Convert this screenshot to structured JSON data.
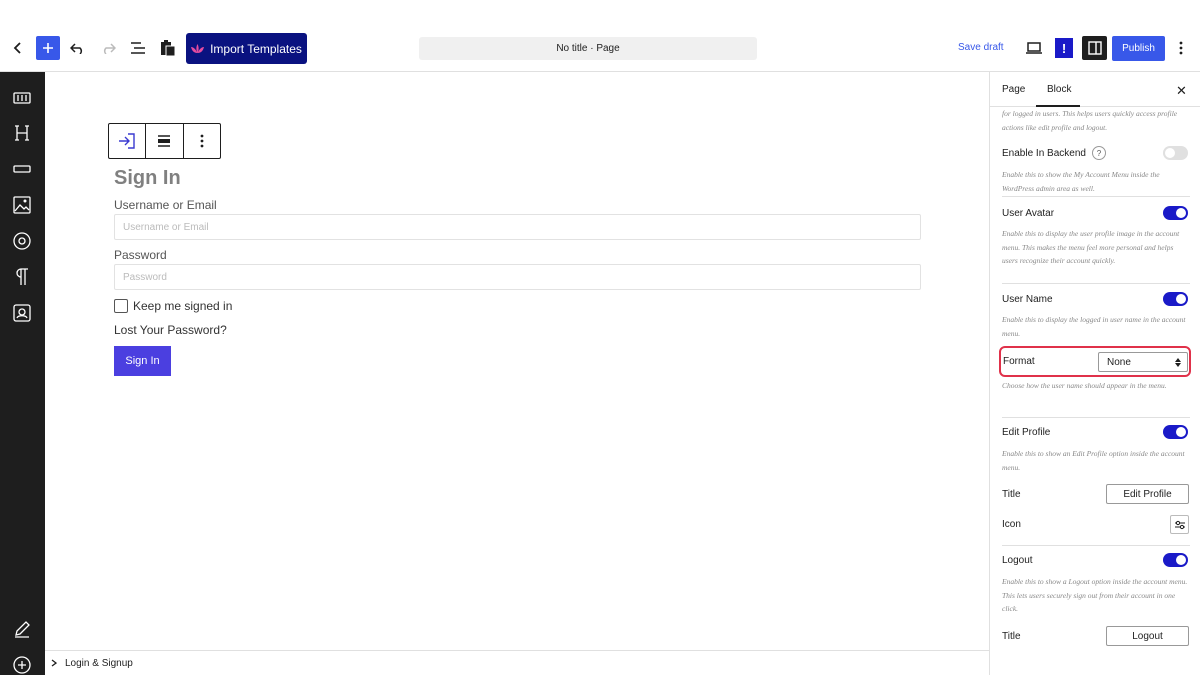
{
  "toolbar": {
    "import_label": "Import Templates",
    "doc_title": "No title · Page",
    "save_draft": "Save draft",
    "alert": "!",
    "publish": "Publish"
  },
  "canvas": {
    "title": "Sign In",
    "username_label": "Username or Email",
    "username_placeholder": "Username or Email",
    "password_label": "Password",
    "password_placeholder": "Password",
    "remember_label": "Keep me signed in",
    "lost_password": "Lost Your Password?",
    "submit_label": "Sign In"
  },
  "footer": {
    "breadcrumb": "Login & Signup"
  },
  "panel": {
    "tabs": [
      "Page",
      "Block"
    ],
    "active_tab": "Block",
    "top_help": "for logged in users. This helps users quickly access profile actions like edit profile and logout.",
    "enable_backend": {
      "label": "Enable In Backend",
      "badge": "?",
      "on": false,
      "help": "Enable this to show the My Account Menu inside the WordPress admin area as well."
    },
    "user_avatar": {
      "label": "User Avatar",
      "on": true,
      "help": "Enable this to display the user profile image in the account menu. This makes the menu feel more personal and helps users recognize their account quickly."
    },
    "user_name": {
      "label": "User Name",
      "on": true,
      "help": "Enable this to display the logged in user name in the account menu."
    },
    "format": {
      "label": "Format",
      "value": "None",
      "help": "Choose how the user name should appear in the menu."
    },
    "edit_profile": {
      "label": "Edit Profile",
      "on": true,
      "help": "Enable this to show an Edit Profile option inside the account menu.",
      "title_label": "Title",
      "title_value": "Edit Profile",
      "icon_label": "Icon"
    },
    "logout": {
      "label": "Logout",
      "on": true,
      "help": "Enable this to show a Logout option inside the account menu. This lets users securely sign out from their account in one click.",
      "title_label": "Title",
      "title_value": "Logout"
    }
  },
  "colors": {
    "accent": "#3858e9",
    "toggle_on": "#1a1ac8",
    "import_bg": "#0a1280",
    "highlight": "#e0314a",
    "signin_btn": "#4b3fe0"
  },
  "icons": [
    "back-icon",
    "plus-icon",
    "undo-icon",
    "redo-icon",
    "list-view-icon",
    "clipboard-icon",
    "preview-icon",
    "sidebar-icon",
    "more-vertical-icon",
    "layout-icon",
    "heading-icon",
    "button-block-icon",
    "image-icon",
    "circle-icon",
    "paragraph-icon",
    "profile-icon",
    "edit-pen-icon",
    "add-circle-icon",
    "login-icon",
    "align-icon",
    "close-icon",
    "icon-settings-icon"
  ]
}
